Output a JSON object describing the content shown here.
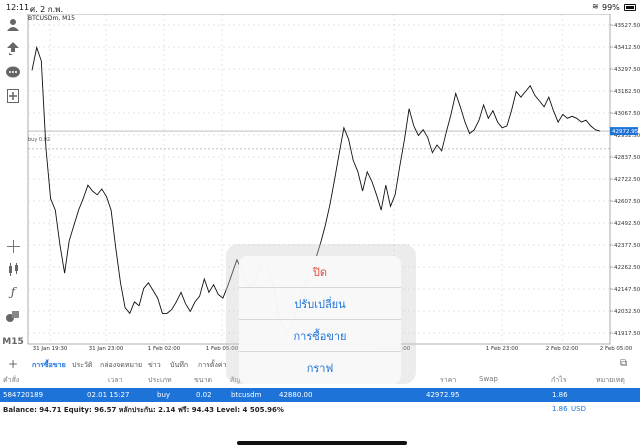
{
  "status_bar": {
    "time": "12:11",
    "date": "ศ. 2 ก.พ.",
    "battery": "99%"
  },
  "chart": {
    "title": "BTCUSDm, M15",
    "buy_label": "buy 0.02",
    "current_price": "42972.95",
    "y_ticks": [
      "43527.50",
      "43412.50",
      "43297.50",
      "43182.50",
      "43067.50",
      "42952.50",
      "42837.50",
      "42722.50",
      "42607.50",
      "42492.50",
      "42377.50",
      "42262.50",
      "42147.50",
      "42032.50",
      "41917.50"
    ],
    "x_ticks": [
      "31 Jan 19:30",
      "31 Jan 23:00",
      "1 Feb 02:00",
      "1 Feb 05:00",
      "1 Feb 17:00",
      "1 Feb 23:00",
      "2 Feb 02:00",
      "2 Feb 05:00"
    ]
  },
  "chart_data": {
    "type": "line",
    "title": "BTCUSDm, M15",
    "ylim": [
      41860,
      43585
    ],
    "series": [
      {
        "values": [
          43290,
          43410,
          43340,
          42880,
          42620,
          42560,
          42380,
          42230,
          42400,
          42480,
          42560,
          42620,
          42690,
          42660,
          42640,
          42670,
          42630,
          42560,
          42360,
          42180,
          42050,
          42020,
          42080,
          42060,
          42150,
          42180,
          42140,
          42100,
          42020,
          42020,
          42040,
          42080,
          42130,
          42070,
          42030,
          42080,
          42110,
          42200,
          42130,
          42170,
          42120,
          42100,
          42160,
          42230,
          42300,
          42250,
          42180,
          42160,
          42200,
          42270,
          42290,
          42230,
          42150,
          42000,
          41950,
          41920,
          41970,
          42050,
          42120,
          42200,
          42240,
          42310,
          42390,
          42480,
          42590,
          42720,
          42860,
          42990,
          42930,
          42820,
          42760,
          42660,
          42760,
          42710,
          42640,
          42560,
          42690,
          42580,
          42640,
          42790,
          42930,
          43090,
          43000,
          42950,
          42980,
          42940,
          42860,
          42900,
          42870,
          42970,
          43060,
          43170,
          43100,
          43020,
          42960,
          42980,
          43030,
          43110,
          43040,
          43080,
          43020,
          42990,
          43000,
          43080,
          43180,
          43150,
          43180,
          43210,
          43160,
          43130,
          43100,
          43150,
          43080,
          43020,
          43060,
          43040,
          43050,
          43040,
          43020,
          43030,
          43000,
          42980,
          42972.95
        ]
      }
    ],
    "horizontal_lines": [
      {
        "label": "buy 0.02",
        "value": 42880
      }
    ],
    "current_price": 42972.95
  },
  "toolbar": {
    "timeframe": "M15",
    "icons": [
      "account-icon",
      "trade-icon",
      "chat-icon",
      "new-order-icon",
      "crosshair-icon",
      "indicators-icon",
      "objects-icon",
      "shapes-icon"
    ]
  },
  "tabs": {
    "items": [
      "การซื้อขาย",
      "ประวัติ",
      "กล่องจดหมาย",
      "ข่าว",
      "บันทึก",
      "การตั้งค่า"
    ]
  },
  "table": {
    "headers": [
      "คำสั่ง",
      "เวลา",
      "ประเภท",
      "ขนาด",
      "สัญลักษณ์",
      "ราคา",
      "Swap",
      "กำไร",
      "หมายเหตุ"
    ],
    "row": {
      "order": "584720189",
      "time": "02.01 15:27",
      "type": "buy",
      "volume": "0.02",
      "symbol": "btcusdm",
      "open_price": "42880.00",
      "price": "42972.95",
      "profit": "1.86"
    },
    "summary": {
      "text": "Balance: 94.71 Equity: 96.57 หลักประกัน: 2.14 ฟรี: 94.43 Level: 4 505.96%",
      "profit": "1.86",
      "currency": "USD"
    }
  },
  "action_sheet": {
    "items": [
      "ปิด",
      "ปรับเปลี่ยน",
      "การซื้อขาย",
      "กราฟ"
    ]
  },
  "colors": {
    "accent": "#1e73d9",
    "danger": "#e64a3a",
    "line": "#111111"
  }
}
